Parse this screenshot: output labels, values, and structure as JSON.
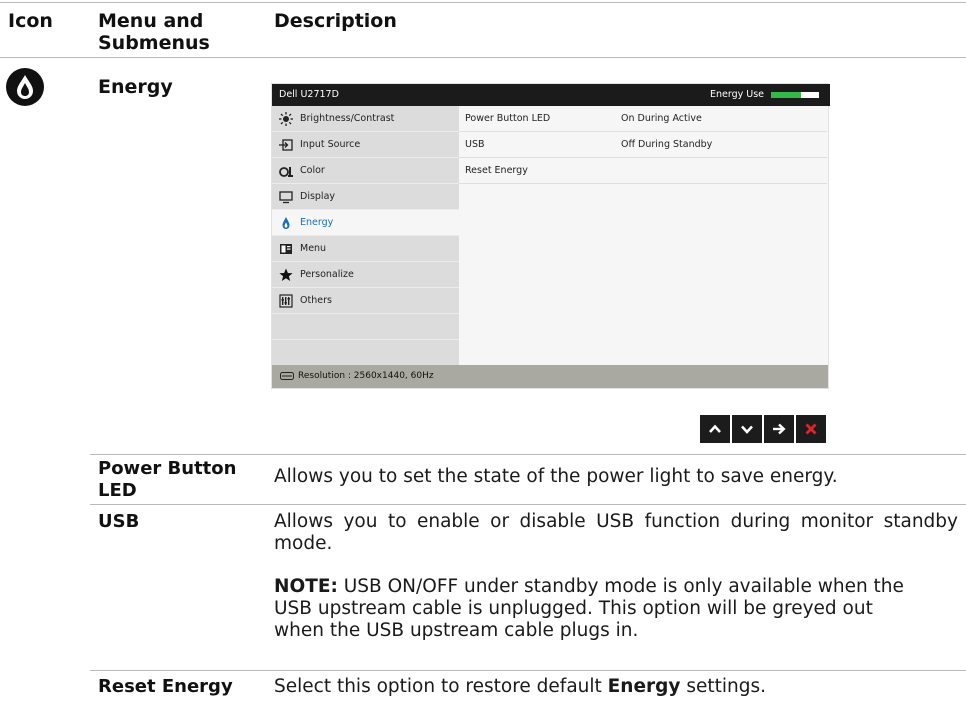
{
  "table": {
    "col_icon": "Icon",
    "col_menu": "Menu and Submenus",
    "col_desc": "Description"
  },
  "section": {
    "icon": "energy-drop-icon",
    "name": "Energy"
  },
  "osd": {
    "model": "Dell U2717D",
    "energy_use_label": "Energy Use",
    "energy_use_level": 0.62,
    "menu": [
      {
        "icon": "brightness-icon",
        "label": "Brightness/Contrast"
      },
      {
        "icon": "input-source-icon",
        "label": "Input Source"
      },
      {
        "icon": "color-icon",
        "label": "Color"
      },
      {
        "icon": "display-icon",
        "label": "Display"
      },
      {
        "icon": "energy-icon",
        "label": "Energy",
        "selected": true
      },
      {
        "icon": "menu-icon",
        "label": "Menu"
      },
      {
        "icon": "star-icon",
        "label": "Personalize"
      },
      {
        "icon": "others-icon",
        "label": "Others"
      }
    ],
    "submenu": [
      {
        "label": "Power Button LED",
        "value": "On During Active"
      },
      {
        "label": "USB",
        "value": "Off During Standby"
      },
      {
        "label": "Reset Energy",
        "value": ""
      }
    ],
    "status": "Resolution : 2560x1440, 60Hz"
  },
  "nav_buttons": [
    "up-arrow-icon",
    "down-arrow-icon",
    "right-arrow-icon",
    "close-icon"
  ],
  "rows": [
    {
      "term": "Power Button LED",
      "desc": "Allows you to set the state of the power light to save energy."
    },
    {
      "term": "USB",
      "desc": "Allows you to enable or disable USB function during monitor standby mode.",
      "note_label": "NOTE:",
      "note": "USB ON/OFF under standby mode is only available when the USB upstream cable is unplugged. This option will be greyed out when the USB upstream cable plugs in."
    },
    {
      "term": "Reset Energy",
      "desc_pre": "Select this option to restore default ",
      "desc_bold": "Energy",
      "desc_post": " settings."
    }
  ],
  "colors": {
    "accent_blue": "#1a6fb5",
    "meter_green": "#35b84a",
    "close_red": "#e0242c"
  }
}
